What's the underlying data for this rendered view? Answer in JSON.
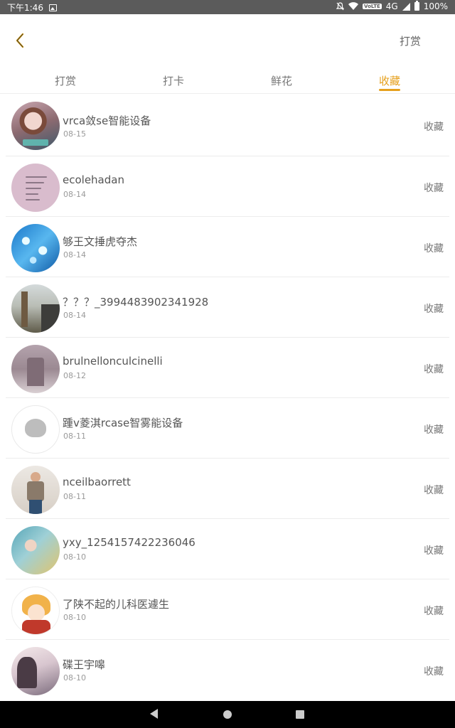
{
  "status_bar": {
    "time": "下午1:46",
    "network": "4G",
    "volte": "VoLTE",
    "battery": "100%"
  },
  "header": {
    "action_label": "打赏"
  },
  "tabs": [
    {
      "label": "打赏",
      "active": false
    },
    {
      "label": "打卡",
      "active": false
    },
    {
      "label": "鲜花",
      "active": false
    },
    {
      "label": "收藏",
      "active": true
    }
  ],
  "list": [
    {
      "name": "vrca敛se智能设备",
      "date": "08-15",
      "action": "收藏"
    },
    {
      "name": "ecolehadan",
      "date": "08-14",
      "action": "收藏"
    },
    {
      "name": "够王文捶虎夺杰",
      "date": "08-14",
      "action": "收藏"
    },
    {
      "name": "？？？_3994483902341928",
      "date": "08-14",
      "action": "收藏"
    },
    {
      "name": "brulnellonculcinelli",
      "date": "08-12",
      "action": "收藏"
    },
    {
      "name": "踵v菱淇rcase智雾能设备",
      "date": "08-11",
      "action": "收藏"
    },
    {
      "name": "nceilbaorrett",
      "date": "08-11",
      "action": "收藏"
    },
    {
      "name": "yxy_1254157422236046",
      "date": "08-10",
      "action": "收藏"
    },
    {
      "name": "了陕不起的儿科医遽生",
      "date": "08-10",
      "action": "收藏"
    },
    {
      "name": "碟王宇嗥",
      "date": "08-10",
      "action": "收藏"
    }
  ],
  "colors": {
    "accent": "#e6a01d",
    "status_bar": "#5b5b5b"
  },
  "icons": {
    "back": "chevron-left-icon",
    "gallery": "gallery-icon",
    "wifi": "wifi-icon",
    "signal": "signal-icon",
    "battery": "battery-icon",
    "mute": "mute-icon"
  }
}
